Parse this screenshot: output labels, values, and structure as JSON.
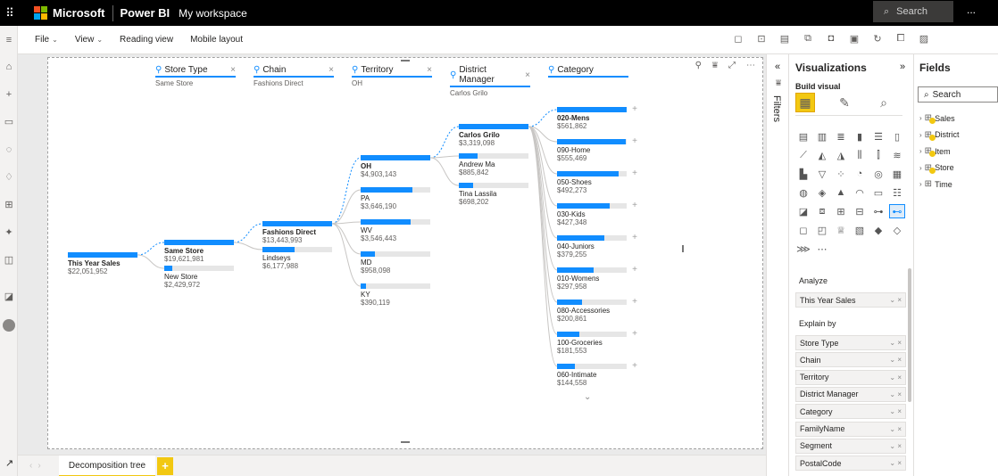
{
  "topbar": {
    "waffle_icon": "waffle-icon",
    "brand": "Microsoft",
    "app": "Power BI",
    "workspace": "My workspace",
    "search_placeholder": "Search",
    "more": "..."
  },
  "menubar": {
    "items": [
      {
        "label": "File",
        "has_chevron": true
      },
      {
        "label": "View",
        "has_chevron": true
      },
      {
        "label": "Reading view",
        "has_chevron": false
      },
      {
        "label": "Mobile layout",
        "has_chevron": false
      }
    ]
  },
  "decomp_tree": {
    "levels": [
      {
        "title": "Store Type",
        "sub": "Same Store"
      },
      {
        "title": "Chain",
        "sub": "Fashions Direct"
      },
      {
        "title": "Territory",
        "sub": "OH"
      },
      {
        "title": "District Manager",
        "sub": "Carlos Grilo"
      },
      {
        "title": "Category",
        "sub": ""
      }
    ],
    "root": {
      "label": "This Year Sales",
      "value": "$22,051,952"
    },
    "store_type": [
      {
        "label": "Same Store",
        "value": "$19,621,981",
        "fill": 1.0,
        "selected": true
      },
      {
        "label": "New Store",
        "value": "$2,429,972",
        "fill": 0.12,
        "selected": false
      }
    ],
    "chain": [
      {
        "label": "Fashions Direct",
        "value": "$13,443,993",
        "fill": 1.0,
        "selected": true
      },
      {
        "label": "Lindseys",
        "value": "$6,177,988",
        "fill": 0.46,
        "selected": false
      }
    ],
    "territory": [
      {
        "label": "OH",
        "value": "$4,903,143",
        "fill": 1.0,
        "selected": true
      },
      {
        "label": "PA",
        "value": "$3,646,190",
        "fill": 0.74,
        "selected": false
      },
      {
        "label": "WV",
        "value": "$3,546,443",
        "fill": 0.72,
        "selected": false
      },
      {
        "label": "MD",
        "value": "$958,098",
        "fill": 0.2,
        "selected": false
      },
      {
        "label": "KY",
        "value": "$390,119",
        "fill": 0.08,
        "selected": false
      }
    ],
    "district_manager": [
      {
        "label": "Carlos Grilo",
        "value": "$3,319,098",
        "fill": 1.0,
        "selected": true
      },
      {
        "label": "Andrew Ma",
        "value": "$885,842",
        "fill": 0.27,
        "selected": false
      },
      {
        "label": "Tina Lassila",
        "value": "$698,202",
        "fill": 0.21,
        "selected": false
      }
    ],
    "category": [
      {
        "label": "020-Mens",
        "value": "$561,862",
        "fill": 1.0,
        "selected": true
      },
      {
        "label": "090-Home",
        "value": "$555,469",
        "fill": 0.99,
        "selected": false
      },
      {
        "label": "050-Shoes",
        "value": "$492,273",
        "fill": 0.88,
        "selected": false
      },
      {
        "label": "030-Kids",
        "value": "$427,348",
        "fill": 0.76,
        "selected": false
      },
      {
        "label": "040-Juniors",
        "value": "$379,255",
        "fill": 0.68,
        "selected": false
      },
      {
        "label": "010-Womens",
        "value": "$297,958",
        "fill": 0.53,
        "selected": false
      },
      {
        "label": "080-Accessories",
        "value": "$200,861",
        "fill": 0.36,
        "selected": false
      },
      {
        "label": "100-Groceries",
        "value": "$181,553",
        "fill": 0.32,
        "selected": false
      },
      {
        "label": "060-Intimate",
        "value": "$144,558",
        "fill": 0.26,
        "selected": false
      }
    ]
  },
  "tabs": {
    "page": "Decomposition tree",
    "add": "+"
  },
  "filters": {
    "label": "Filters"
  },
  "visualizations": {
    "title": "Visualizations",
    "build_label": "Build visual",
    "analyze_label": "Analyze",
    "analyze_field": "This Year Sales",
    "explain_label": "Explain by",
    "explain_fields": [
      "Store Type",
      "Chain",
      "Territory",
      "District Manager",
      "Category",
      "FamilyName",
      "Segment",
      "PostalCode"
    ]
  },
  "fields": {
    "title": "Fields",
    "search_placeholder": "Search",
    "tables": [
      {
        "name": "Sales",
        "checked": true
      },
      {
        "name": "District",
        "checked": true
      },
      {
        "name": "Item",
        "checked": true
      },
      {
        "name": "Store",
        "checked": true
      },
      {
        "name": "Time",
        "checked": false
      }
    ]
  },
  "colors": {
    "accent": "#118dff",
    "track": "#e6e6e6",
    "highlight": "#f2c811",
    "topbar": "#000000"
  }
}
